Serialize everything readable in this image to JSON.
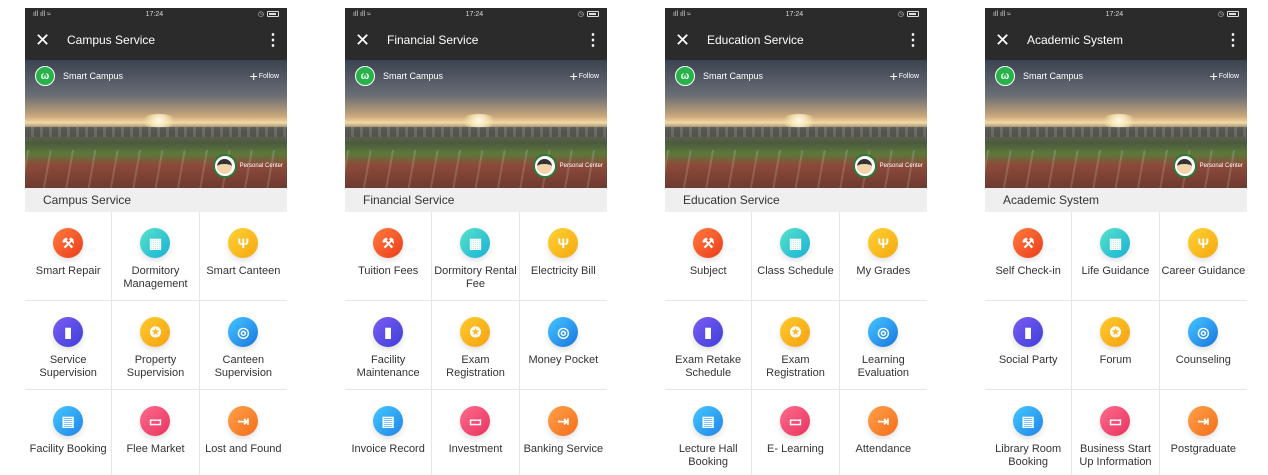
{
  "status_bar": {
    "signal": "ıll ıll ≈",
    "time": "17:24",
    "alarm": "◷"
  },
  "common": {
    "brand_logo": "ω",
    "brand_name": "Smart Campus",
    "follow_label": "Follow",
    "personal_center": "Personal Center"
  },
  "phones": [
    {
      "title": "Campus Service",
      "section": "Campus Service",
      "tiles": [
        {
          "label": "Smart Repair",
          "icon": "tools-icon"
        },
        {
          "label": "Dormitory Management",
          "icon": "building-icon"
        },
        {
          "label": "Smart Canteen",
          "icon": "fork-knife-icon"
        },
        {
          "label": "Service Supervision",
          "icon": "bookmark-icon"
        },
        {
          "label": "Property Supervision",
          "icon": "shield-icon"
        },
        {
          "label": "Canteen Supervision",
          "icon": "shield-check-icon"
        },
        {
          "label": "Facility Booking",
          "icon": "booking-icon"
        },
        {
          "label": "Flee Market",
          "icon": "store-icon"
        },
        {
          "label": "Lost and Found",
          "icon": "return-box-icon"
        }
      ]
    },
    {
      "title": "Financial Service",
      "section": "Financial Service",
      "tiles": [
        {
          "label": "Tuition Fees",
          "icon": "tools-icon"
        },
        {
          "label": "Dormitory Rental Fee",
          "icon": "building-icon"
        },
        {
          "label": "Electricity Bill",
          "icon": "fork-knife-icon"
        },
        {
          "label": "Facility Maintenance",
          "icon": "bookmark-icon"
        },
        {
          "label": "Exam Registration",
          "icon": "shield-icon"
        },
        {
          "label": "Money Pocket",
          "icon": "shield-check-icon"
        },
        {
          "label": "Invoice Record",
          "icon": "booking-icon"
        },
        {
          "label": "Investment",
          "icon": "store-icon"
        },
        {
          "label": "Banking Service",
          "icon": "return-box-icon"
        }
      ]
    },
    {
      "title": "Education Service",
      "section": "Education Service",
      "tiles": [
        {
          "label": "Subject",
          "icon": "tools-icon"
        },
        {
          "label": "Class Schedule",
          "icon": "building-icon"
        },
        {
          "label": "My Grades",
          "icon": "fork-knife-icon"
        },
        {
          "label": "Exam Retake Schedule",
          "icon": "bookmark-icon"
        },
        {
          "label": "Exam Registration",
          "icon": "shield-icon"
        },
        {
          "label": "Learning Evaluation",
          "icon": "shield-check-icon"
        },
        {
          "label": "Lecture Hall Booking",
          "icon": "booking-icon"
        },
        {
          "label": "E- Learning",
          "icon": "store-icon"
        },
        {
          "label": "Attendance",
          "icon": "return-box-icon"
        }
      ]
    },
    {
      "title": "Academic System",
      "section": "Academic System",
      "tiles": [
        {
          "label": "Self Check-in",
          "icon": "tools-icon"
        },
        {
          "label": "Life Guidance",
          "icon": "building-icon"
        },
        {
          "label": "Career Guidance",
          "icon": "fork-knife-icon"
        },
        {
          "label": "Social Party",
          "icon": "bookmark-icon"
        },
        {
          "label": "Forum",
          "icon": "shield-icon"
        },
        {
          "label": "Counseling",
          "icon": "shield-check-icon"
        },
        {
          "label": "Library Room Booking",
          "icon": "booking-icon"
        },
        {
          "label": "Business Start Up Information",
          "icon": "store-icon"
        },
        {
          "label": "Postgraduate",
          "icon": "return-box-icon"
        }
      ]
    }
  ]
}
